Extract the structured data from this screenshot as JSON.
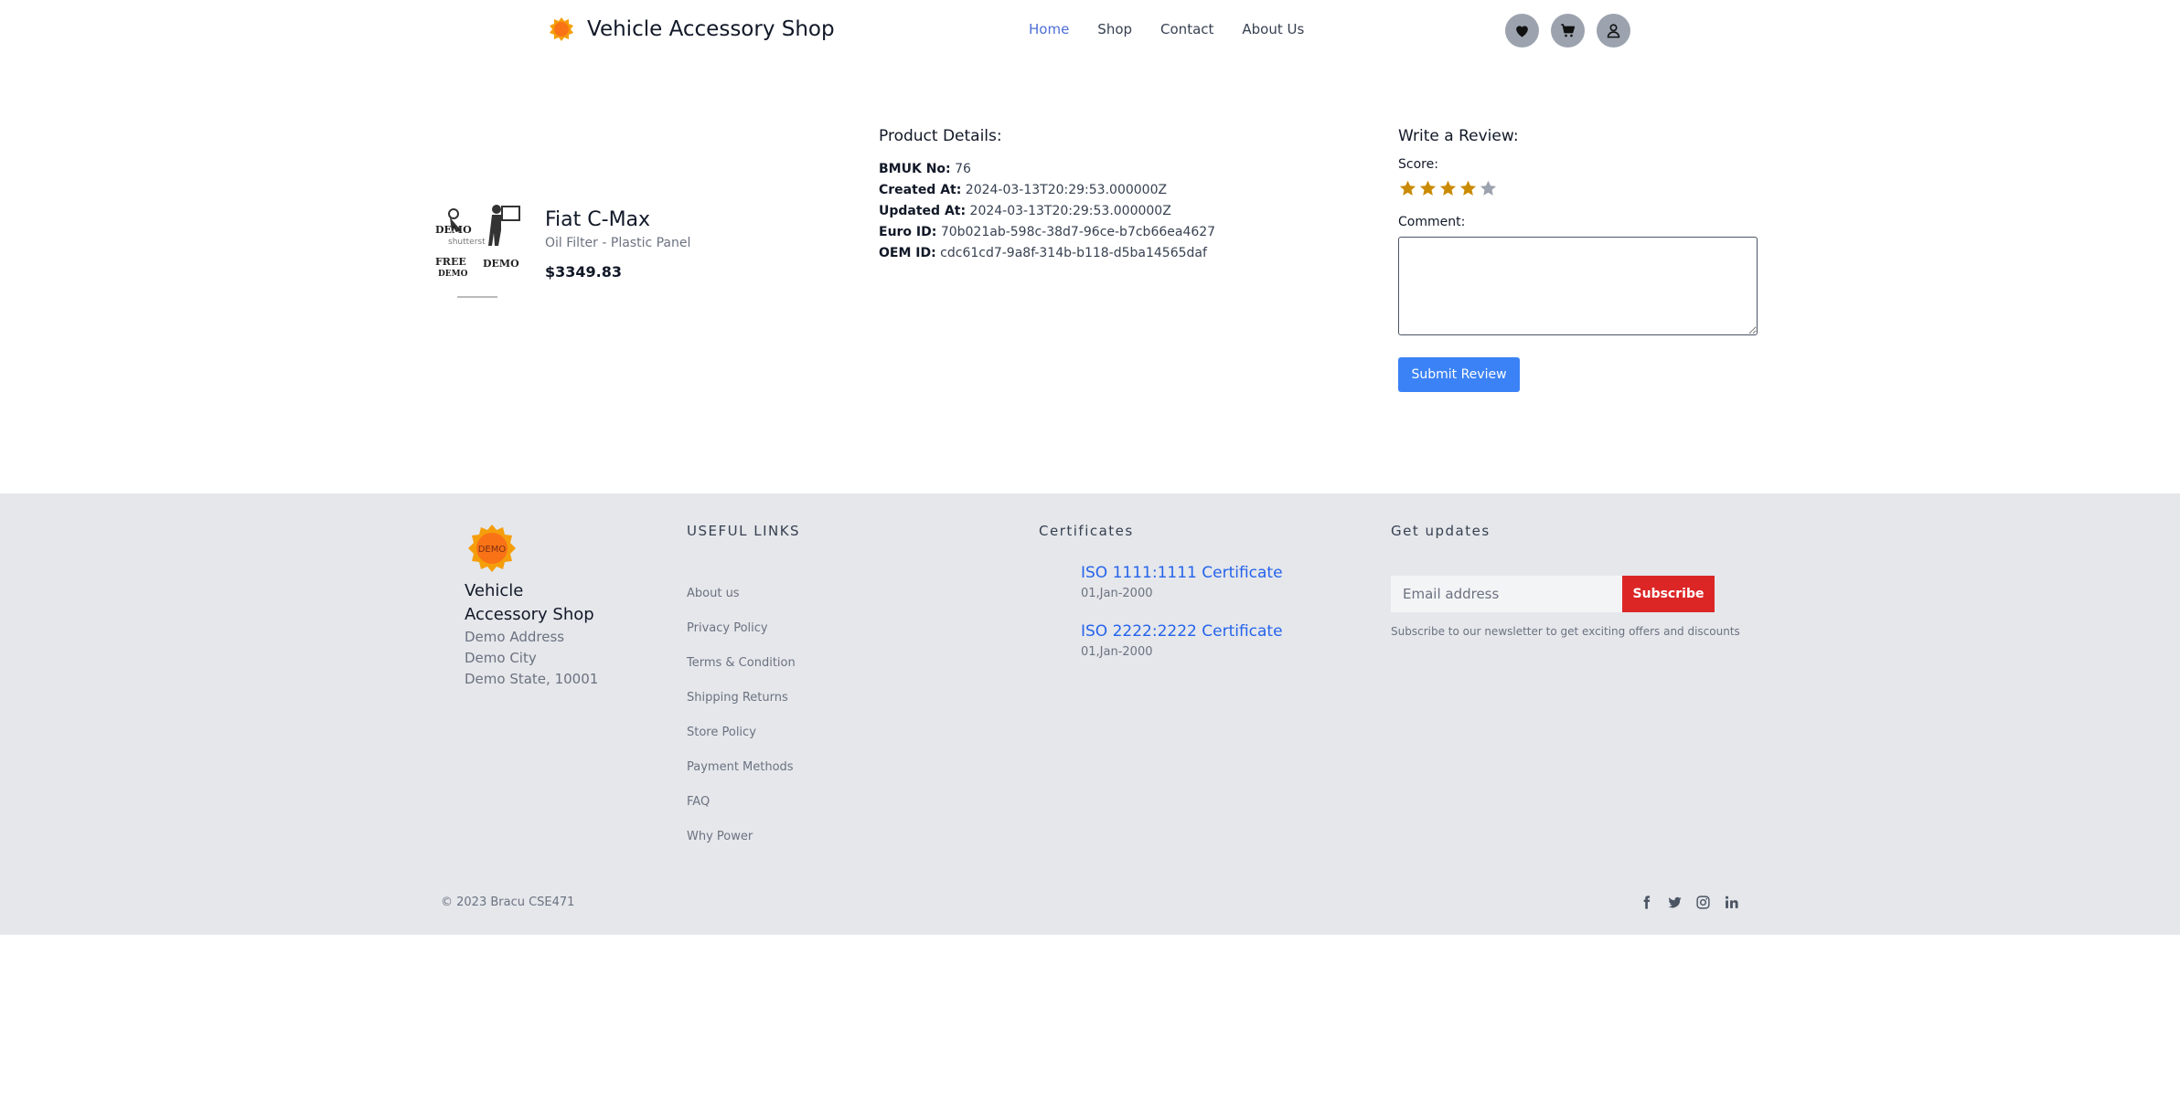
{
  "header": {
    "brand_name": "Vehicle Accessory Shop",
    "nav": [
      "Home",
      "Shop",
      "Contact",
      "About Us"
    ],
    "icons": [
      "heart-icon",
      "cart-icon",
      "user-icon"
    ]
  },
  "product": {
    "name": "Fiat C-Max",
    "subtitle": "Oil Filter - Plastic Panel",
    "price": "$3349.83"
  },
  "details": {
    "title": "Product Details:",
    "rows": [
      {
        "label": "BMUK No:",
        "value": "76"
      },
      {
        "label": "Created At:",
        "value": "2024-03-13T20:29:53.000000Z"
      },
      {
        "label": "Updated At:",
        "value": "2024-03-13T20:29:53.000000Z"
      },
      {
        "label": "Euro ID:",
        "value": "70b021ab-598c-38d7-96ce-b7cb66ea4627"
      },
      {
        "label": "OEM ID:",
        "value": "cdc61cd7-9a8f-314b-b118-d5ba14565daf"
      }
    ]
  },
  "review": {
    "title": "Write a Review:",
    "score_label": "Score:",
    "score": 4,
    "max_score": 5,
    "comment_label": "Comment:",
    "comment_value": "",
    "submit_label": "Submit Review"
  },
  "footer": {
    "brand_name": "Vehicle Accessory Shop",
    "address": [
      "Demo Address",
      "Demo City",
      "Demo State, 10001"
    ],
    "links_title": "USEFUL LINKS",
    "links": [
      "About us",
      "Privacy Policy",
      "Terms & Condition",
      "Shipping Returns",
      "Store Policy",
      "Payment Methods",
      "FAQ",
      "Why Power"
    ],
    "certs_title": "Certificates",
    "certs": [
      {
        "name": "ISO 1111:1111 Certificate",
        "date": "01,Jan-2000"
      },
      {
        "name": "ISO 2222:2222 Certificate",
        "date": "01,Jan-2000"
      }
    ],
    "updates_title": "Get updates",
    "email_placeholder": "Email address",
    "subscribe_label": "Subscribe",
    "subscribe_note": "Subscribe to our newsletter to get exciting offers and discounts",
    "copyright": "© 2023 Bracu CSE471",
    "socials": [
      "facebook-icon",
      "twitter-icon",
      "instagram-icon",
      "linkedin-icon"
    ]
  },
  "colors": {
    "accent": "#3b82f6",
    "nav_active": "#4f6fd6",
    "subscribe": "#dc2626",
    "star": "#ca8a04",
    "footer_bg": "#e5e7eb"
  }
}
